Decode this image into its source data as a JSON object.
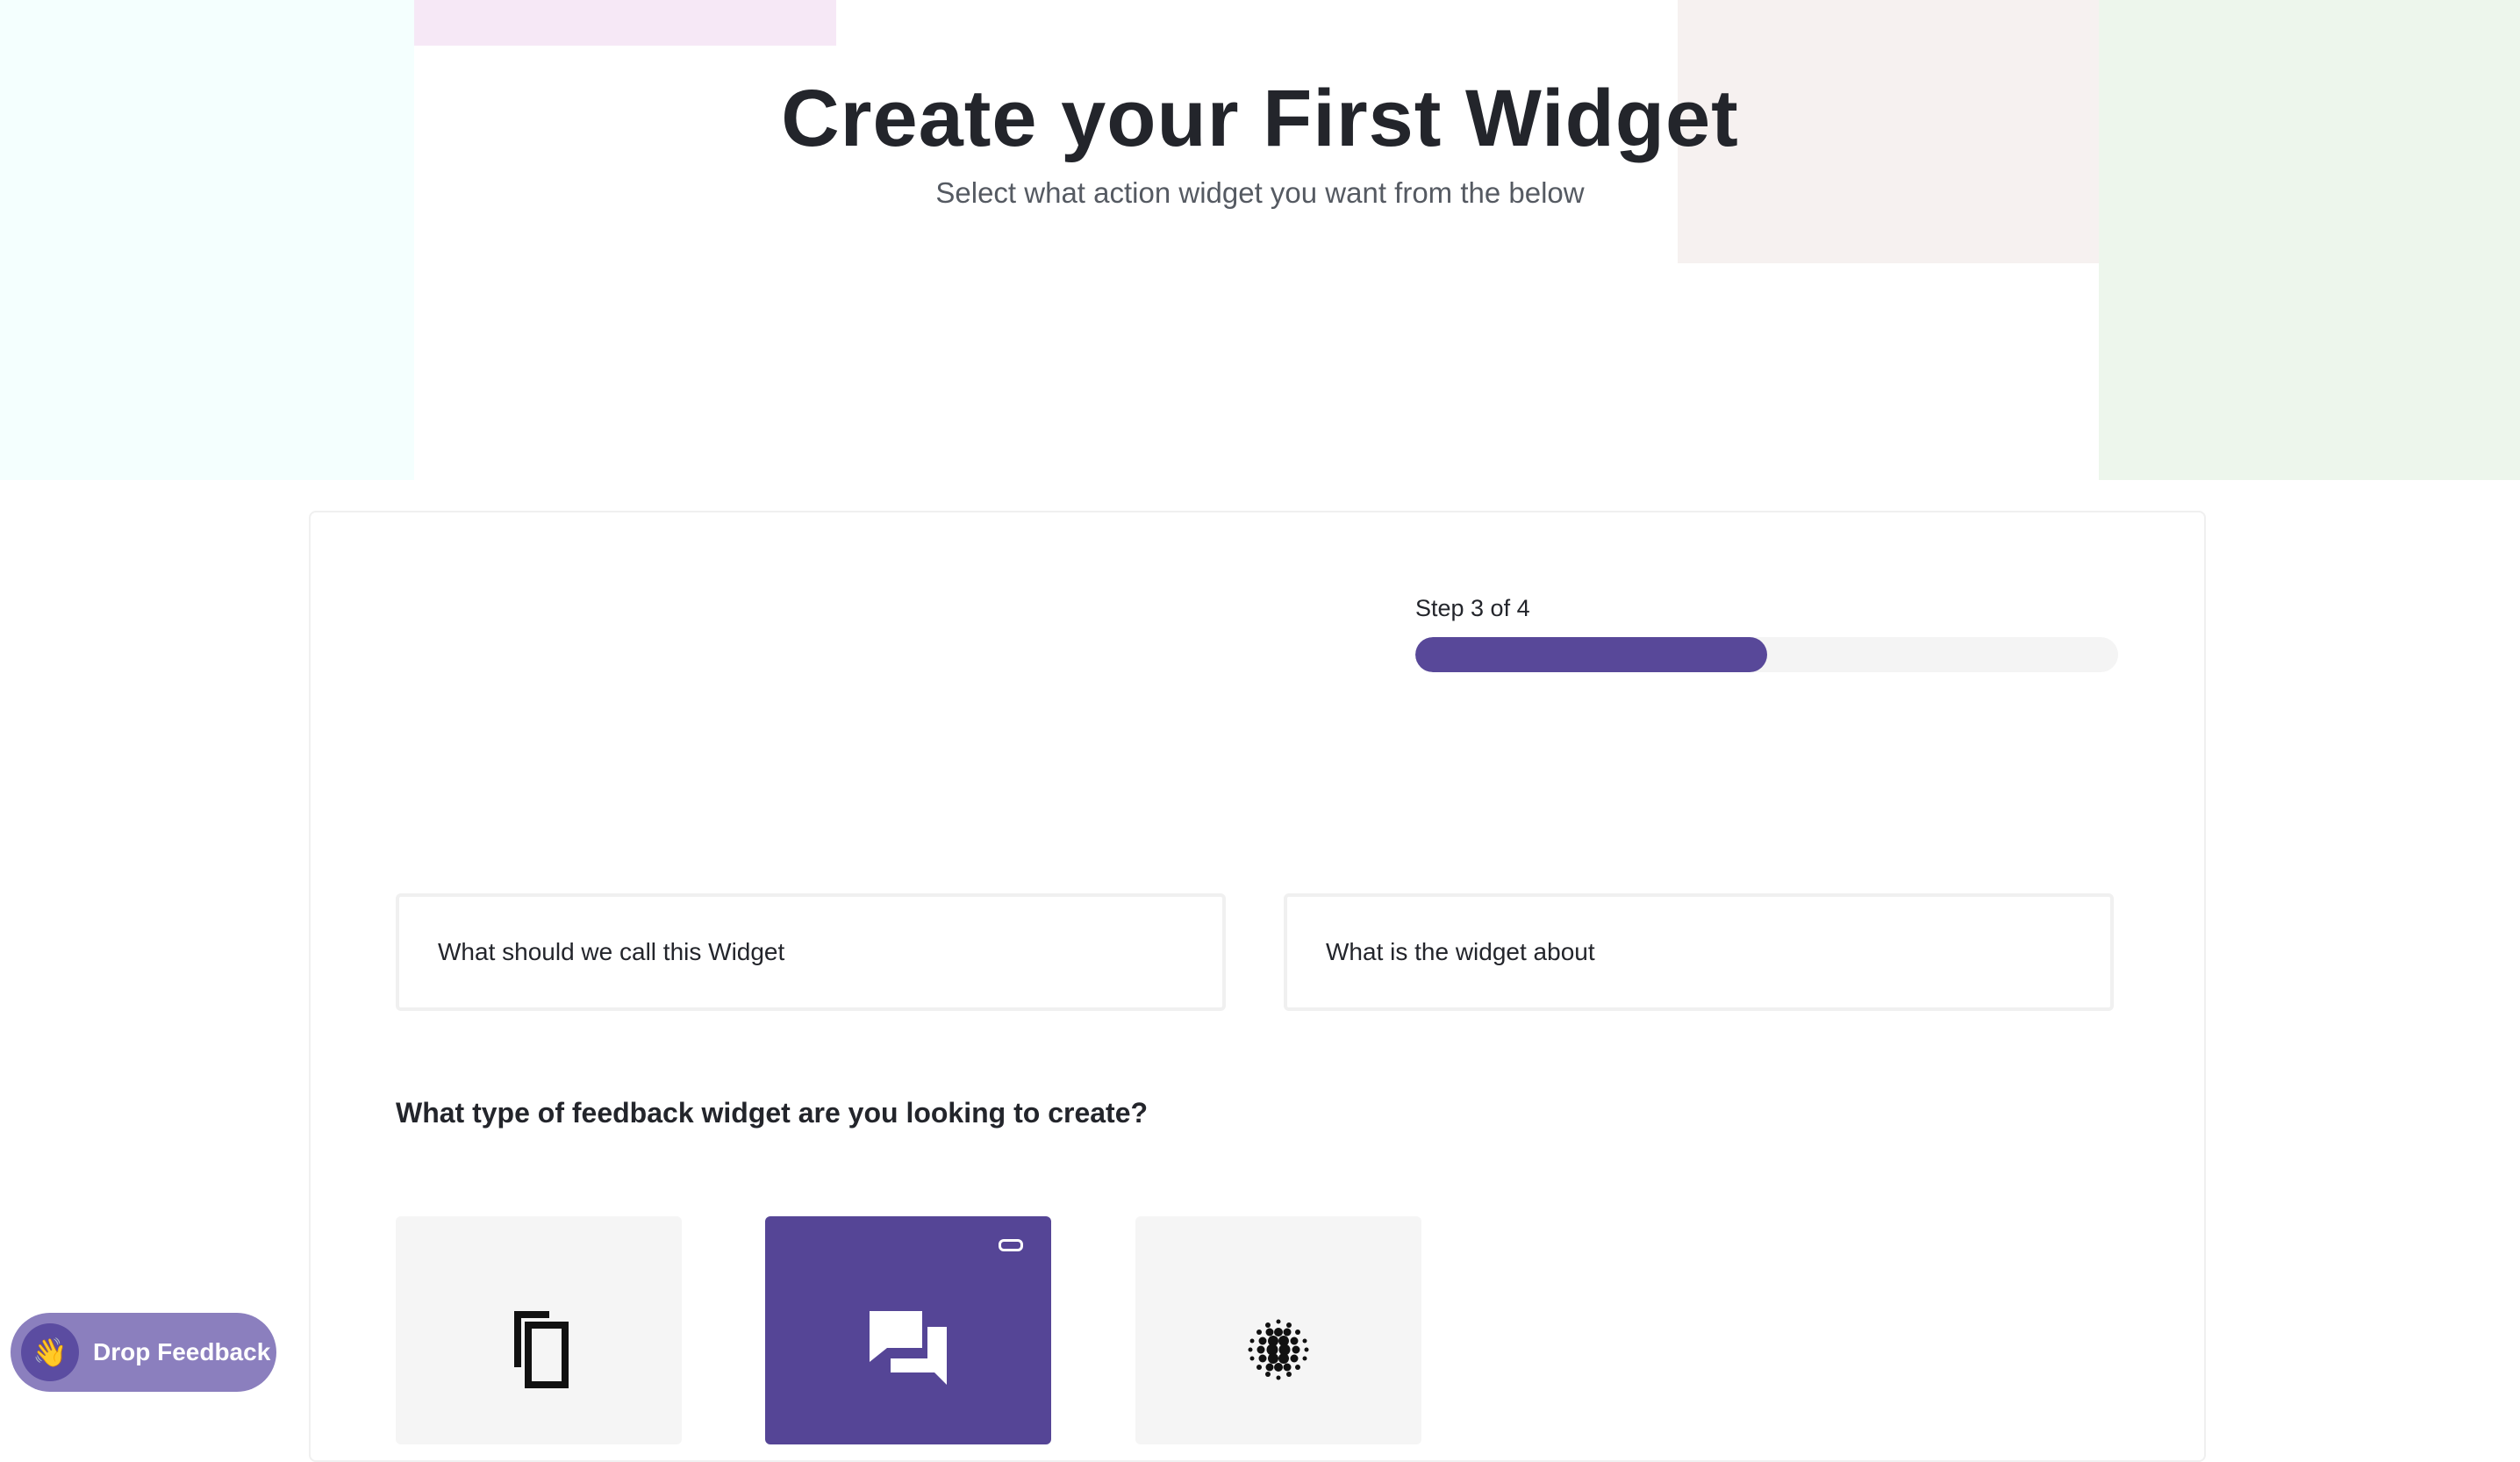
{
  "header": {
    "title": "Create your First Widget",
    "subtitle": "Select what action widget you want from the below"
  },
  "progress": {
    "label": "Step 3 of 4",
    "current_step": 3,
    "total_steps": 4,
    "fill_fraction": 0.5
  },
  "form": {
    "name_placeholder": "What should we call this Widget",
    "about_placeholder": "What is the widget about",
    "question": "What type of feedback widget are you looking to create?"
  },
  "widget_types": [
    {
      "icon": "copy-icon",
      "selected": false
    },
    {
      "icon": "chat-bubbles-icon",
      "selected": true
    },
    {
      "icon": "dot-sphere-icon",
      "selected": false
    }
  ],
  "feedback_button": {
    "label": "Drop Feedback",
    "icon": "waving-hand-icon"
  },
  "colors": {
    "accent": "#584899",
    "selected_tile": "#554596",
    "feedback_button": "#8b7fbe",
    "text": "#23252b"
  }
}
